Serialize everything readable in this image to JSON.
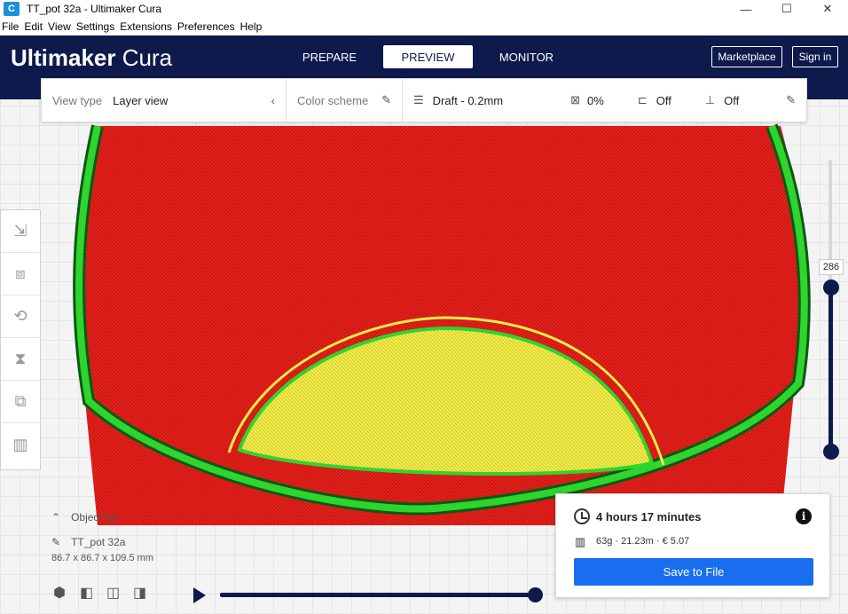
{
  "window": {
    "title": "TT_pot 32a - Ultimaker Cura",
    "app_icon": "cura-app-icon",
    "minimize": "—",
    "maximize": "☐",
    "close": "✕"
  },
  "menu": [
    "File",
    "Edit",
    "View",
    "Settings",
    "Extensions",
    "Preferences",
    "Help"
  ],
  "header": {
    "brand_bold": "Ultimaker",
    "brand_light": "Cura",
    "tabs": [
      "PREPARE",
      "PREVIEW",
      "MONITOR"
    ],
    "active_tab": "PREVIEW",
    "marketplace": "Marketplace",
    "sign_in": "Sign in",
    "bg_color": "#0e1a4c"
  },
  "view_toolbar": {
    "view_type_label": "View type",
    "view_type_value": "Layer view",
    "color_scheme_label": "Color scheme",
    "profile": "Draft - 0.2mm",
    "infill": "0%",
    "support": "Off",
    "adhesion": "Off"
  },
  "object_list": {
    "label": "Object list",
    "object_name": "TT_pot 32a",
    "dimensions": "86.7 x 86.7 x 109.5 mm"
  },
  "layer_slider": {
    "current_layer": "286"
  },
  "print_info": {
    "time": "4 hours 17 minutes",
    "stats": "63g · 21.23m · € 5.07",
    "save": "Save to File",
    "button_color": "#196ef0"
  },
  "colors": {
    "wall_outer": "#e8201b",
    "wall_inner": "#2fd42f",
    "skin": "#f2ec4a"
  }
}
